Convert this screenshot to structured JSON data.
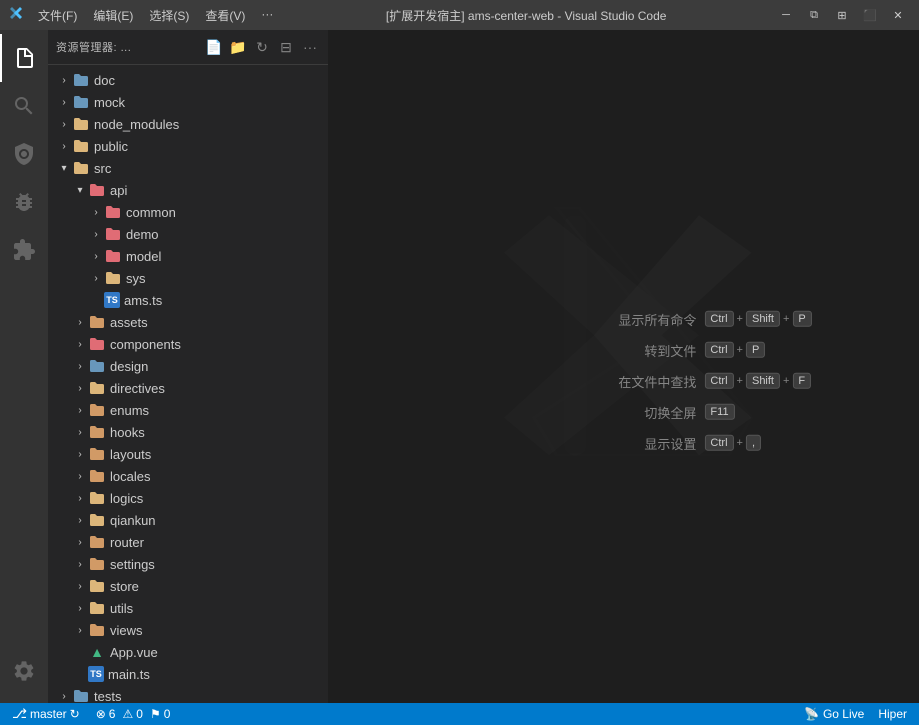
{
  "titleBar": {
    "icon": "🔷",
    "menu": [
      "文件(F)",
      "编辑(E)",
      "选择(S)",
      "查看(V)",
      "···"
    ],
    "title": "[扩展开发宿主] ams-center-web - Visual Studio Code",
    "controls": {
      "minimize": "🗕",
      "restore": "🗗",
      "split": "⬜",
      "grid": "⊞",
      "close": "✕"
    }
  },
  "activityBar": {
    "items": [
      {
        "name": "explorer",
        "icon": "⎘"
      },
      {
        "name": "search",
        "icon": "🔍"
      },
      {
        "name": "git",
        "icon": "⎇"
      },
      {
        "name": "debug",
        "icon": "▶"
      },
      {
        "name": "extensions",
        "icon": "⊞"
      }
    ],
    "bottom": {
      "name": "settings",
      "icon": "⚙"
    }
  },
  "sidebar": {
    "title": "资源管理器: ...",
    "actions": {
      "new_file": "📄",
      "new_folder": "📁",
      "refresh": "↻",
      "collapse": "⊟",
      "more": "···"
    },
    "tree": [
      {
        "id": "doc",
        "label": "doc",
        "type": "folder",
        "indent": 0,
        "expanded": false,
        "color": "blue"
      },
      {
        "id": "mock",
        "label": "mock",
        "type": "folder",
        "indent": 0,
        "expanded": false,
        "color": "blue"
      },
      {
        "id": "node_modules",
        "label": "node_modules",
        "type": "folder",
        "indent": 0,
        "expanded": false,
        "color": "default"
      },
      {
        "id": "public",
        "label": "public",
        "type": "folder",
        "indent": 0,
        "expanded": false,
        "color": "default"
      },
      {
        "id": "src",
        "label": "src",
        "type": "folder",
        "indent": 0,
        "expanded": true,
        "color": "default"
      },
      {
        "id": "api",
        "label": "api",
        "type": "folder",
        "indent": 1,
        "expanded": true,
        "color": "pink"
      },
      {
        "id": "common",
        "label": "common",
        "type": "folder",
        "indent": 2,
        "expanded": false,
        "color": "pink"
      },
      {
        "id": "demo",
        "label": "demo",
        "type": "folder",
        "indent": 2,
        "expanded": false,
        "color": "pink"
      },
      {
        "id": "model",
        "label": "model",
        "type": "folder",
        "indent": 2,
        "expanded": false,
        "color": "pink"
      },
      {
        "id": "sys",
        "label": "sys",
        "type": "folder",
        "indent": 2,
        "expanded": false,
        "color": "default"
      },
      {
        "id": "ams_ts",
        "label": "ams.ts",
        "type": "file-ts",
        "indent": 2,
        "expanded": false
      },
      {
        "id": "assets",
        "label": "assets",
        "type": "folder",
        "indent": 1,
        "expanded": false,
        "color": "orange"
      },
      {
        "id": "components",
        "label": "components",
        "type": "folder",
        "indent": 1,
        "expanded": false,
        "color": "pink"
      },
      {
        "id": "design",
        "label": "design",
        "type": "folder",
        "indent": 1,
        "expanded": false,
        "color": "blue"
      },
      {
        "id": "directives",
        "label": "directives",
        "type": "folder",
        "indent": 1,
        "expanded": false,
        "color": "default"
      },
      {
        "id": "enums",
        "label": "enums",
        "type": "folder",
        "indent": 1,
        "expanded": false,
        "color": "orange"
      },
      {
        "id": "hooks",
        "label": "hooks",
        "type": "folder",
        "indent": 1,
        "expanded": false,
        "color": "orange"
      },
      {
        "id": "layouts",
        "label": "layouts",
        "type": "folder",
        "indent": 1,
        "expanded": false,
        "color": "orange"
      },
      {
        "id": "locales",
        "label": "locales",
        "type": "folder",
        "indent": 1,
        "expanded": false,
        "color": "orange"
      },
      {
        "id": "logics",
        "label": "logics",
        "type": "folder",
        "indent": 1,
        "expanded": false,
        "color": "default"
      },
      {
        "id": "qiankun",
        "label": "qiankun",
        "type": "folder",
        "indent": 1,
        "expanded": false,
        "color": "default"
      },
      {
        "id": "router",
        "label": "router",
        "type": "folder",
        "indent": 1,
        "expanded": false,
        "color": "orange"
      },
      {
        "id": "settings",
        "label": "settings",
        "type": "folder",
        "indent": 1,
        "expanded": false,
        "color": "orange"
      },
      {
        "id": "store",
        "label": "store",
        "type": "folder",
        "indent": 1,
        "expanded": false,
        "color": "default"
      },
      {
        "id": "utils",
        "label": "utils",
        "type": "folder",
        "indent": 1,
        "expanded": false,
        "color": "default"
      },
      {
        "id": "views",
        "label": "views",
        "type": "folder",
        "indent": 1,
        "expanded": false,
        "color": "orange"
      },
      {
        "id": "app_vue",
        "label": "App.vue",
        "type": "file-vue",
        "indent": 1
      },
      {
        "id": "main_ts",
        "label": "main.ts",
        "type": "file-ts",
        "indent": 1
      },
      {
        "id": "tests",
        "label": "tests",
        "type": "folder",
        "indent": 0,
        "expanded": false,
        "color": "blue"
      }
    ]
  },
  "editor": {
    "watermark": true,
    "hints": [
      {
        "label": "显示所有命令",
        "keys": [
          "Ctrl",
          "+",
          "Shift",
          "+",
          "P"
        ]
      },
      {
        "label": "转到文件",
        "keys": [
          "Ctrl",
          "+",
          "P"
        ]
      },
      {
        "label": "在文件中查找",
        "keys": [
          "Ctrl",
          "+",
          "Shift",
          "+",
          "F"
        ]
      },
      {
        "label": "切换全屏",
        "keys": [
          "F11"
        ]
      },
      {
        "label": "显示设置",
        "keys": [
          "Ctrl",
          "+",
          ","
        ]
      }
    ]
  },
  "statusBar": {
    "branch": "master",
    "sync": "↻",
    "errors": "⊗ 6",
    "warnings": "⚠ 0",
    "info": "⚑ 0",
    "goLive": "Go Live",
    "hiper": "Hiper"
  }
}
